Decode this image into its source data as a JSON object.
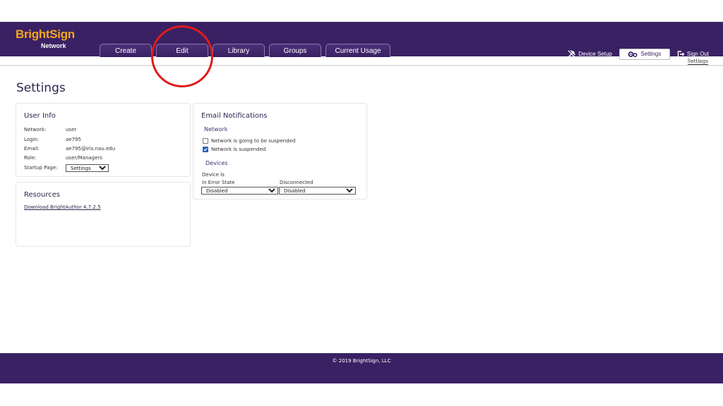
{
  "brand": {
    "name": "BrightSign",
    "sub": "Network",
    "accent_color": "#f3a81c",
    "header_color": "#3a2163"
  },
  "nav": {
    "tabs": [
      {
        "label": "Create"
      },
      {
        "label": "Edit"
      },
      {
        "label": "Library"
      },
      {
        "label": "Groups"
      },
      {
        "label": "Current Usage"
      }
    ]
  },
  "top_actions": {
    "device_setup": "Device Setup",
    "settings": "Settings",
    "sign_out": "Sign Out"
  },
  "subnav": {
    "active": "Settings"
  },
  "page": {
    "title": "Settings"
  },
  "user_info": {
    "title": "User Info",
    "rows": [
      {
        "label": "Network:",
        "value": "user"
      },
      {
        "label": "Login:",
        "value": "ae795"
      },
      {
        "label": "Email:",
        "value": "ae795@iris.nau.edu"
      },
      {
        "label": "Role:",
        "value": "user/Managers"
      }
    ],
    "startup_page": {
      "label": "Startup Page:",
      "value": "Settings"
    }
  },
  "resources": {
    "title": "Resources",
    "link": "Download BrightAuthor 4.7.2.5"
  },
  "email_notifications": {
    "title": "Email Notifications",
    "network": {
      "heading": "Network",
      "options": [
        {
          "label": "Network is going to be suspended",
          "checked": false
        },
        {
          "label": "Network is suspended",
          "checked": true
        }
      ]
    },
    "devices": {
      "heading": "Devices",
      "device_is": "Device Is",
      "error_state": {
        "label": "In Error State",
        "value": "Disabled"
      },
      "disconnected": {
        "label": "Disconnected",
        "value": "Disabled"
      }
    }
  },
  "footer": {
    "copyright": "© 2019 BrightSign, LLC"
  },
  "annotation": {
    "color": "#e11b1b"
  }
}
